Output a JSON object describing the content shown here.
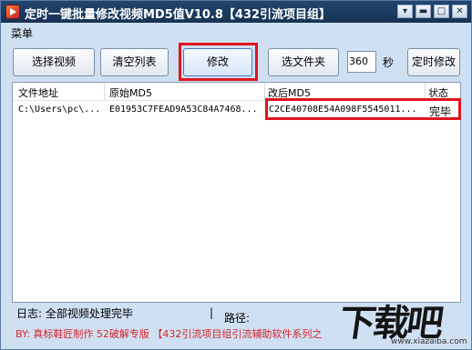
{
  "window": {
    "title": "定时一键批量修改视频MD5值V10.8【432引流项目组】",
    "controls": {
      "menu": "▾",
      "minimize": "▬",
      "maximize": "□",
      "close": "✕"
    }
  },
  "menu": {
    "label": "菜单"
  },
  "toolbar": {
    "select_video": "选择视频",
    "clear_list": "清空列表",
    "modify": "修改",
    "select_folder": "选文件夹",
    "seconds_value": "360",
    "seconds_label": "秒",
    "timed_modify": "定时修改"
  },
  "table": {
    "headers": [
      "文件地址",
      "原始MD5",
      "改后MD5",
      "状态"
    ],
    "rows": [
      [
        "C:\\Users\\pc\\...",
        "E01953C7FEAD9A53C84A7468...",
        "C2CE40708E54A098F5545011...",
        "完毕"
      ]
    ]
  },
  "status": {
    "log": "日志: 全部视频处理完毕",
    "separator": "|",
    "path_label": "路径:"
  },
  "footer": "BY: 真标鞋匠制作 52破解专版 【432引流项目组引流辅助软件系列之",
  "watermark": {
    "text": "下载吧",
    "url": "www.xiazaiba.com"
  },
  "colors": {
    "highlight": "#e0141e",
    "footer_text": "#d6262a",
    "window_bg": "#cfe0f3",
    "titlebar": "#1d3b60"
  }
}
